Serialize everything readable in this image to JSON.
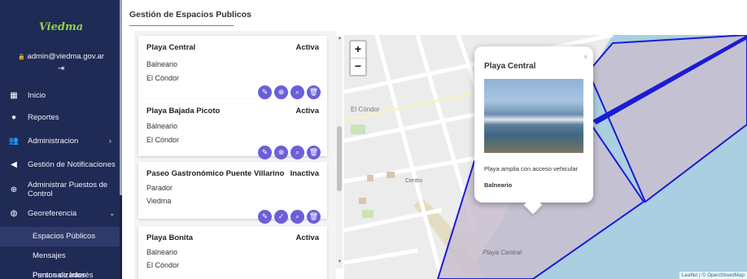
{
  "sidebar": {
    "logo": "Viedma",
    "user_email": "admin@viedma.gov.ar",
    "lock_glyph": "🔒",
    "items": [
      {
        "label": "Inicio",
        "icon": "dashboard-icon"
      },
      {
        "label": "Reportes",
        "icon": "alert-circle-icon"
      },
      {
        "label": "Administracion",
        "icon": "users-icon",
        "chevron": "›"
      },
      {
        "label": "Gestión de Notificaciones",
        "icon": "megaphone-icon"
      },
      {
        "label": "Administrar Puestos de Control",
        "icon": "plus-circle-icon"
      },
      {
        "label": "Georeferencia",
        "icon": "globe-icon",
        "chevron": "⌄"
      }
    ],
    "subitems": [
      {
        "label": "Espacios Públicos",
        "active": true
      },
      {
        "label": "Mensajes Personalizados",
        "active": false
      },
      {
        "label": "Puntos de Interés",
        "active": false
      }
    ]
  },
  "header": {
    "title": "Gestión de Espacios Publicos"
  },
  "cards": [
    {
      "name": "Playa Central",
      "status": "Activa",
      "type": "Balneario",
      "place": "El Cóndor",
      "toggle_icon": "deactivate-icon"
    },
    {
      "name": "Playa Bajada Picoto",
      "status": "Activa",
      "type": "Balneario",
      "place": "El Cóndor",
      "toggle_icon": "deactivate-icon"
    },
    {
      "name": "Paseo Gastronómico Puente Villarino",
      "status": "Inactiva",
      "type": "Parador",
      "place": "Viedma",
      "toggle_icon": "activate-check-icon"
    },
    {
      "name": "Playa Bonita",
      "status": "Activa",
      "type": "Balneario",
      "place": "El Cóndor"
    }
  ],
  "map": {
    "zoom_in": "+",
    "zoom_out": "−",
    "labels": {
      "el_condor": "El Cóndor",
      "centro": "Centro",
      "playa_central": "Playa Central"
    },
    "attribution": "Leaflet | © OpenStreetMap",
    "colors": {
      "sea": "#a9cfe0",
      "land": "#ececec",
      "polygon_fill": "#c9bfcf",
      "polygon_stroke": "#1b1bd6"
    }
  },
  "popup": {
    "close": "×",
    "title": "Playa Central",
    "description": "Playa amplia con acceso vehicular",
    "type": "Balneario"
  }
}
